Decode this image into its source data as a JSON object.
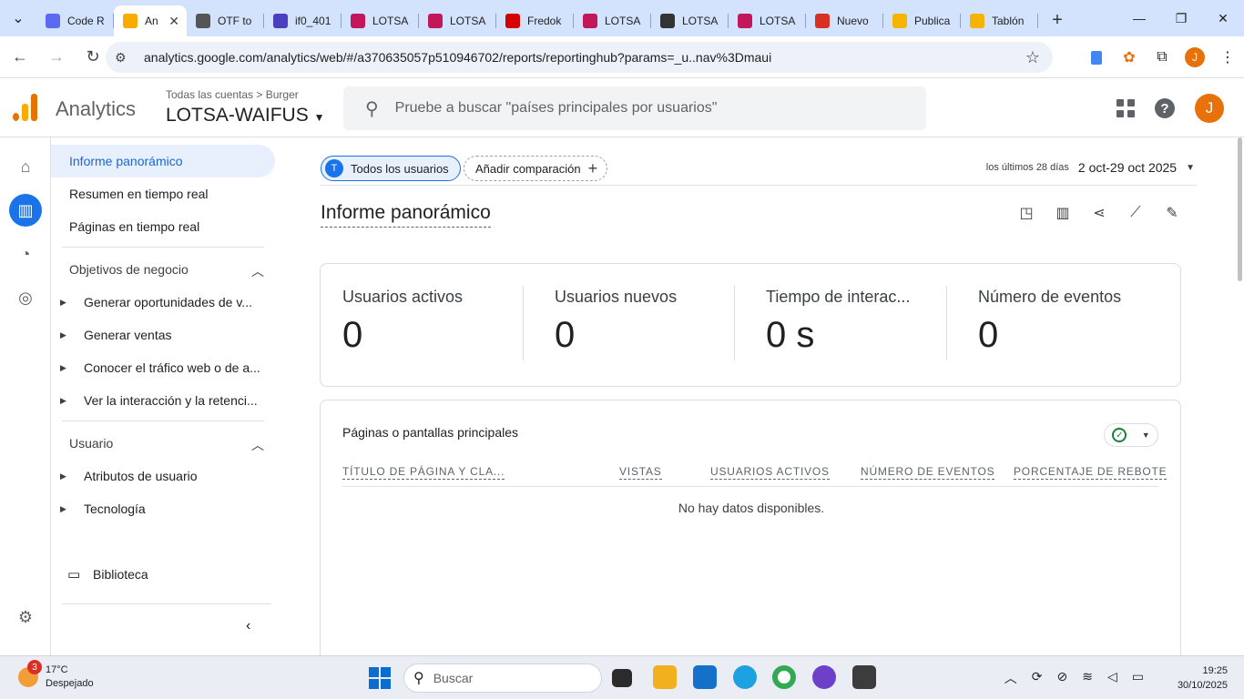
{
  "browser": {
    "tabs": [
      {
        "label": "Code R",
        "icon": "github-copilot-icon",
        "color": "#5b6af0"
      },
      {
        "label": "An",
        "icon": "analytics-icon",
        "color": "#f9ab00",
        "active": true
      },
      {
        "label": "OTF to",
        "icon": "cloud-icon",
        "color": "#555555"
      },
      {
        "label": "if0_401",
        "icon": "infinity-icon",
        "color": "#4b3fbf"
      },
      {
        "label": "LOTSA",
        "icon": "character-icon",
        "color": "#c2185b"
      },
      {
        "label": "LOTSA",
        "icon": "character-icon",
        "color": "#c2185b"
      },
      {
        "label": "Fredok",
        "icon": "fredoka-f-icon",
        "color": "#d50000"
      },
      {
        "label": "LOTSA",
        "icon": "character-icon",
        "color": "#c2185b"
      },
      {
        "label": "LOTSA",
        "icon": "globe-icon",
        "color": "#333333"
      },
      {
        "label": "LOTSA",
        "icon": "character-icon",
        "color": "#c2185b"
      },
      {
        "label": "Nuevo",
        "icon": "gmail-icon",
        "color": "#d93025"
      },
      {
        "label": "Publica",
        "icon": "classroom-icon",
        "color": "#f4b400"
      },
      {
        "label": "Tablón",
        "icon": "classroom-icon",
        "color": "#f4b400"
      }
    ],
    "url": "analytics.google.com/analytics/web/#/a370635057p510946702/reports/reportinghub?params=_u..nav%3Dmaui",
    "profile_initial": "J"
  },
  "header": {
    "app_name": "Analytics",
    "breadcrumb": "Todas las cuentas > Burger",
    "property": "LOTSA-WAIFUS",
    "search_placeholder": "Pruebe a buscar \"países principales por usuarios\"",
    "avatar_initial": "J"
  },
  "nav": {
    "top_items": [
      "Informe panorámico",
      "Resumen en tiempo real",
      "Páginas en tiempo real"
    ],
    "section_business": "Objetivos de negocio",
    "business_items": [
      "Generar oportunidades de v...",
      "Generar ventas",
      "Conocer el tráfico web o de a...",
      "Ver la interacción y la retenci..."
    ],
    "section_user": "Usuario",
    "user_items": [
      "Atributos de usuario",
      "Tecnología"
    ],
    "library": "Biblioteca"
  },
  "main": {
    "chip_all": "Todos los usuarios",
    "chip_all_initial": "T",
    "chip_add": "Añadir comparación",
    "date_label": "los últimos 28 días",
    "date_value": "2 oct-29 oct 2025",
    "title": "Informe panorámico",
    "metrics": [
      {
        "label": "Usuarios activos",
        "value": "0"
      },
      {
        "label": "Usuarios nuevos",
        "value": "0"
      },
      {
        "label": "Tiempo de interac...",
        "value": "0 s"
      },
      {
        "label": "Número de eventos",
        "value": "0"
      }
    ],
    "table": {
      "title": "Páginas o pantallas principales",
      "columns": [
        "TÍTULO DE PÁGINA Y CLA...",
        "VISTAS",
        "USUARIOS ACTIVOS",
        "NÚMERO DE EVENTOS",
        "PORCENTAJE DE REBOTE"
      ],
      "empty": "No hay datos disponibles."
    }
  },
  "taskbar": {
    "weather_badge": "3",
    "temp": "17°C",
    "condition": "Despejado",
    "search": "Buscar",
    "time": "19:25",
    "date": "30/10/2025"
  }
}
